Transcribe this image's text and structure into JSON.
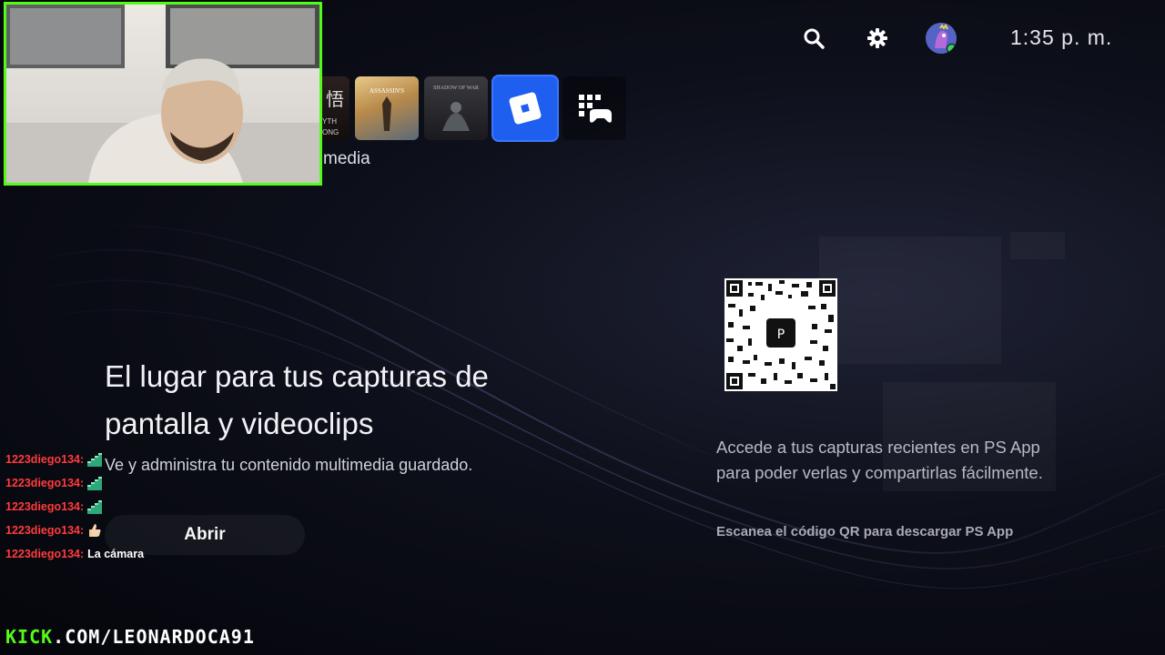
{
  "header": {
    "clock": "1:35 p. m.",
    "icons": [
      "search-icon",
      "gear-icon",
      "avatar"
    ]
  },
  "tiles": {
    "items": [
      {
        "name": "myth-wukong-tile",
        "label_fragment": "YTH\nONG"
      },
      {
        "name": "assassins-creed-origins-tile",
        "label_fragment": ""
      },
      {
        "name": "shadow-of-war-tile",
        "label_fragment": ""
      },
      {
        "name": "roblox-tile",
        "label_fragment": ""
      },
      {
        "name": "game-library-tile",
        "label_fragment": ""
      }
    ],
    "focused_label": "media"
  },
  "main": {
    "title": "El lugar para tus capturas de pantalla y videoclips",
    "subtitle": "Ve y administra tu contenido multimedia guardado.",
    "open_button": "Abrir"
  },
  "qr_panel": {
    "description": "Accede a tus capturas recientes en PS App para poder verlas y compartirlas fácilmente.",
    "hint": "Escanea el código QR para descargar PS App"
  },
  "chat": {
    "messages": [
      {
        "user": "1223diego134:",
        "text": "",
        "emote": "stairs"
      },
      {
        "user": "1223diego134:",
        "text": "",
        "emote": "stairs"
      },
      {
        "user": "1223diego134:",
        "text": "",
        "emote": "stairs"
      },
      {
        "user": "1223diego134:",
        "text": "",
        "emote": "thumbs-up"
      },
      {
        "user": "1223diego134:",
        "text": "La cámara",
        "emote": ""
      }
    ]
  },
  "watermark": {
    "kick": "KICK",
    "rest": ".COM/LEONARDOCA91"
  },
  "colors": {
    "accent_kick": "#53fc18",
    "roblox_blue": "#1f5ff0",
    "chat_user": "#ff3b3b"
  }
}
